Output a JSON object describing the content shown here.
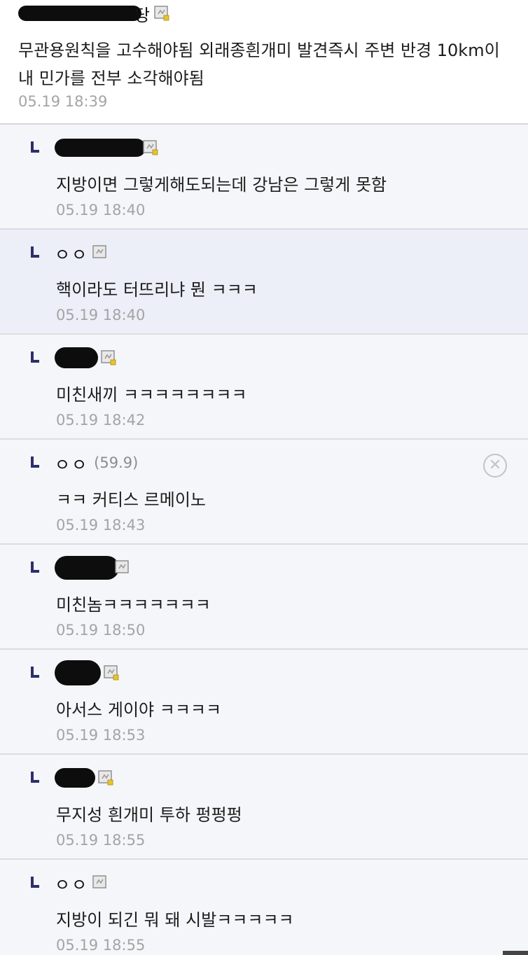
{
  "main_comment": {
    "author_tail": "당",
    "text": "무관용원칙을 고수해야됨 외래종흰개미 발견즉시 주변 반경 10km이내 민가를 전부 소각해야됨",
    "date": "05.19 18:39"
  },
  "replies": [
    {
      "author": "",
      "ip": "",
      "text": "지방이면 그렇게해도되는데 강남은 그렇게 못함",
      "date": "05.19 18:40"
    },
    {
      "author": "ㅇㅇ",
      "ip": "",
      "text": "핵이라도 터뜨리냐 뭔 ㅋㅋㅋ",
      "date": "05.19 18:40"
    },
    {
      "author": "",
      "ip": "",
      "text": "미친새끼 ㅋㅋㅋㅋㅋㅋㅋㅋ",
      "date": "05.19 18:42"
    },
    {
      "author": "ㅇㅇ",
      "ip": "(59.9)",
      "text": "ㅋㅋ 커티스 르메이노",
      "date": "05.19 18:43"
    },
    {
      "author": "",
      "ip": "",
      "text": "미친놈ㅋㅋㅋㅋㅋㅋㅋ",
      "date": "05.19 18:50"
    },
    {
      "author": "",
      "ip": "",
      "text": "아서스 게이야 ㅋㅋㅋㅋ",
      "date": "05.19 18:53"
    },
    {
      "author": "",
      "ip": "",
      "text": "무지성 흰개미 투하 펑펑펑",
      "date": "05.19 18:55"
    },
    {
      "author": "ㅇㅇ",
      "ip": "",
      "text": "지방이 되긴 뭐 돼 시발ㅋㅋㅋㅋㅋ",
      "date": "05.19 18:55"
    }
  ],
  "icons": {
    "gallog": "gallog-icon",
    "reply": "reply-arrow-icon",
    "delete": "close-circle-icon"
  },
  "colors": {
    "reply_bg": "#f5f6f9",
    "highlight_bg": "#eceff8",
    "reply_mark": "#2c2f6b",
    "date": "#a4a4a4"
  }
}
